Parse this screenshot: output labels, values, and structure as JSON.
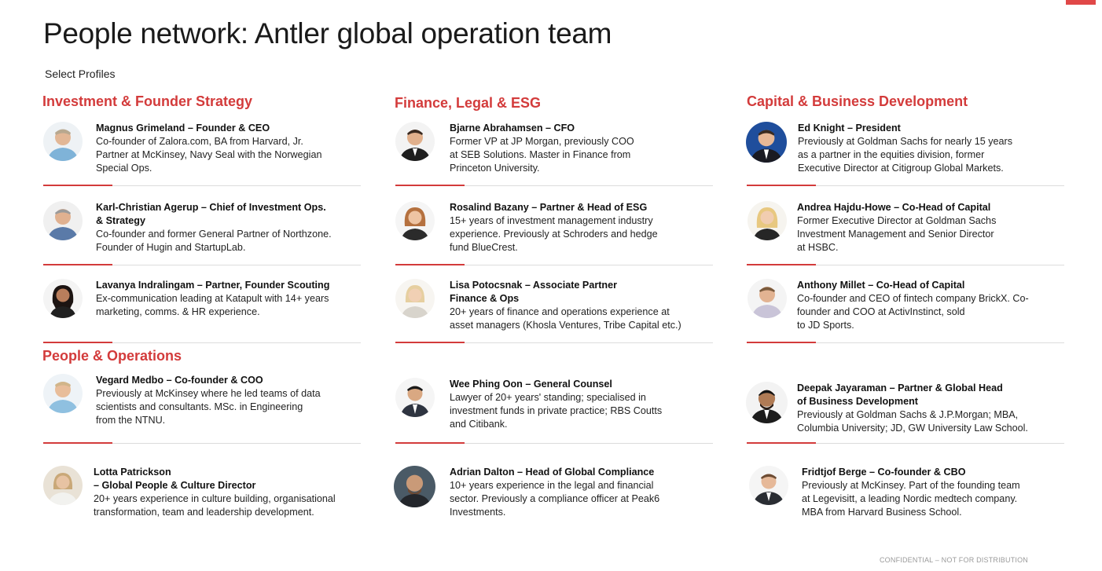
{
  "page": {
    "title": "People network: Antler global operation team",
    "subtitle": "Select Profiles",
    "footer": "CONFIDENTIAL – NOT FOR DISTRIBUTION",
    "accent_color": "#d33b3b"
  },
  "sections": {
    "investment": "Investment & Founder Strategy",
    "finance": "Finance, Legal & ESG",
    "capital": "Capital & Business Development",
    "people": "People & Operations"
  },
  "people": [
    {
      "name": "Magnus Grimeland – Founder & CEO",
      "desc": "Co-founder of Zalora.com,  BA from Harvard, Jr.\nPartner at McKinsey, Navy Seal with the Norwegian\nSpecial Ops.",
      "avatar": "photo-icon"
    },
    {
      "name": "Karl-Christian Agerup – Chief of Investment Ops.\n& Strategy",
      "desc": "Co-founder and former General Partner of Northzone.\nFounder of Hugin and  StartupLab.",
      "avatar": "photo-icon"
    },
    {
      "name": "Lavanya Indralingam – Partner, Founder Scouting",
      "desc": "Ex-communication leading at Katapult with 14+ years\nmarketing, comms. & HR experience.",
      "avatar": "photo-icon"
    },
    {
      "name": "Vegard Medbo – Co-founder & COO",
      "desc": "Previously at McKinsey where he led teams of data\nscientists and consultants. MSc. in Engineering\nfrom the NTNU.",
      "avatar": "photo-icon"
    },
    {
      "name": "Lotta Patrickson\n– Global People & Culture Director",
      "desc": "20+ years experience in culture building, organisational\ntransformation, team and leadership development.",
      "avatar": "photo-icon"
    },
    {
      "name": "Bjarne Abrahamsen – CFO",
      "desc": "Former VP at JP Morgan, previously COO\nat SEB Solutions. Master in Finance from\nPrinceton University.",
      "avatar": "photo-icon"
    },
    {
      "name": "Rosalind Bazany – Partner & Head of ESG",
      "desc": "15+ years of investment management industry\nexperience. Previously at Schroders and hedge\nfund BlueCrest.",
      "avatar": "photo-icon"
    },
    {
      "name": "Lisa Potocsnak – Associate Partner\nFinance & Ops",
      "desc": "20+ years of finance and operations experience at\nasset managers (Khosla Ventures, Tribe Capital etc.)",
      "avatar": "photo-icon"
    },
    {
      "name": "Wee Phing Oon – General Counsel",
      "desc": "Lawyer of 20+ years' standing; specialised in\ninvestment funds in private practice; RBS Coutts\nand Citibank.",
      "avatar": "photo-icon"
    },
    {
      "name": "Adrian Dalton – Head of Global Compliance",
      "desc": "10+ years experience in the legal and financial\nsector. Previously a compliance officer at Peak6\nInvestments.",
      "avatar": "photo-icon"
    },
    {
      "name": "Ed Knight – President",
      "desc": "Previously at Goldman Sachs for nearly 15 years\nas a partner in the equities division, former\nExecutive Director at Citigroup Global Markets.",
      "avatar": "photo-icon"
    },
    {
      "name": "Andrea Hajdu-Howe – Co-Head of Capital",
      "desc": "Former Executive Director at Goldman Sachs\nInvestment Management and Senior Director\nat HSBC.",
      "avatar": "photo-icon"
    },
    {
      "name": "Anthony Millet – Co-Head of Capital",
      "desc": "Co-founder and CEO of fintech company BrickX. Co-\nfounder and COO at ActivInstinct, sold\nto JD Sports.",
      "avatar": "photo-icon"
    },
    {
      "name": "Deepak Jayaraman – Partner &  Global Head\nof Business Development",
      "desc": "Previously at Goldman Sachs & J.P.Morgan; MBA,\nColumbia University; JD, GW University Law School.",
      "avatar": "photo-icon"
    },
    {
      "name": "Fridtjof Berge – Co-founder & CBO",
      "desc": "Previously at McKinsey. Part of the founding team\nat Legevisitt, a leading Nordic medtech company.\nMBA from Harvard Business School.",
      "avatar": "photo-icon"
    }
  ]
}
